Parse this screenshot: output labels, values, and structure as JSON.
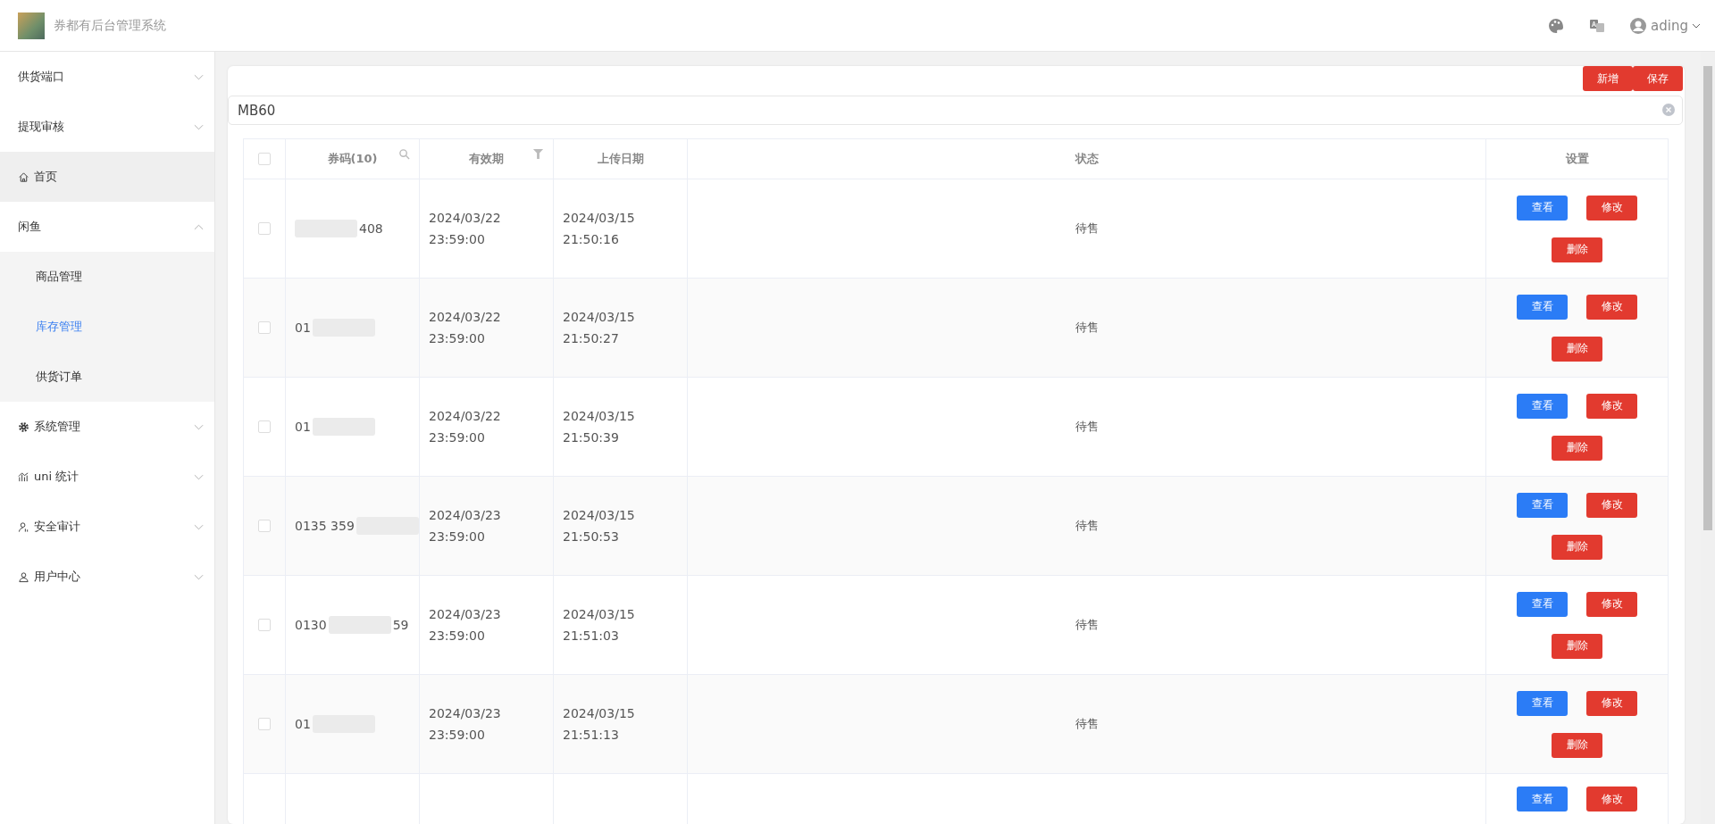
{
  "header": {
    "title": "券都有后台管理系统",
    "user": "ading"
  },
  "sidebar": {
    "items": [
      {
        "label": "供货端口",
        "kind": "group",
        "expanded": false,
        "highlighted": false
      },
      {
        "label": "提现审核",
        "kind": "group",
        "expanded": false,
        "highlighted": false
      },
      {
        "label": "首页",
        "kind": "link",
        "highlighted": true
      },
      {
        "label": "闲鱼",
        "kind": "group",
        "expanded": true,
        "highlighted": false,
        "children": [
          {
            "label": "商品管理",
            "selected": false
          },
          {
            "label": "库存管理",
            "selected": true
          },
          {
            "label": "供货订单",
            "selected": false
          }
        ]
      },
      {
        "label": "系统管理",
        "kind": "group",
        "expanded": false,
        "highlighted": false
      },
      {
        "label": "uni 统计",
        "kind": "group",
        "expanded": false,
        "highlighted": false
      },
      {
        "label": "安全审计",
        "kind": "group",
        "expanded": false,
        "highlighted": false
      },
      {
        "label": "用户中心",
        "kind": "group",
        "expanded": false,
        "highlighted": false
      }
    ]
  },
  "toolbar": {
    "buttons": [
      "新增",
      "保存"
    ]
  },
  "search": {
    "value": "MB60"
  },
  "table": {
    "columns": [
      "券码(10)",
      "有效期",
      "上传日期",
      "状态",
      "设置"
    ],
    "header_checked": false,
    "rows": [
      {
        "checked": false,
        "code_tail": "408",
        "expiry": [
          "2024/03/22",
          "23:59:00"
        ],
        "uploaded": [
          "2024/03/15",
          "21:50:16"
        ],
        "status": "待售",
        "actions": [
          "查看",
          "修改",
          "删除"
        ]
      },
      {
        "checked": false,
        "code_head": "01",
        "expiry": [
          "2024/03/22",
          "23:59:00"
        ],
        "uploaded": [
          "2024/03/15",
          "21:50:27"
        ],
        "status": "待售",
        "actions": [
          "查看",
          "修改",
          "删除"
        ]
      },
      {
        "checked": false,
        "code_head": "01",
        "expiry": [
          "2024/03/22",
          "23:59:00"
        ],
        "uploaded": [
          "2024/03/15",
          "21:50:39"
        ],
        "status": "待售",
        "actions": [
          "查看",
          "修改",
          "删除"
        ]
      },
      {
        "checked": false,
        "code_head": "0135 359",
        "expiry": [
          "2024/03/23",
          "23:59:00"
        ],
        "uploaded": [
          "2024/03/15",
          "21:50:53"
        ],
        "status": "待售",
        "actions": [
          "查看",
          "修改",
          "删除"
        ]
      },
      {
        "checked": false,
        "code_head": "0130",
        "code_tail": "59",
        "expiry": [
          "2024/03/23",
          "23:59:00"
        ],
        "uploaded": [
          "2024/03/15",
          "21:51:03"
        ],
        "status": "待售",
        "actions": [
          "查看",
          "修改",
          "删除"
        ]
      },
      {
        "checked": false,
        "code_head": "01",
        "expiry": [
          "2024/03/23",
          "23:59:00"
        ],
        "uploaded": [
          "2024/03/15",
          "21:51:13"
        ],
        "status": "待售",
        "actions": [
          "查看",
          "修改",
          "删除"
        ]
      },
      {
        "actions": [
          "查看",
          "修改"
        ]
      }
    ]
  }
}
